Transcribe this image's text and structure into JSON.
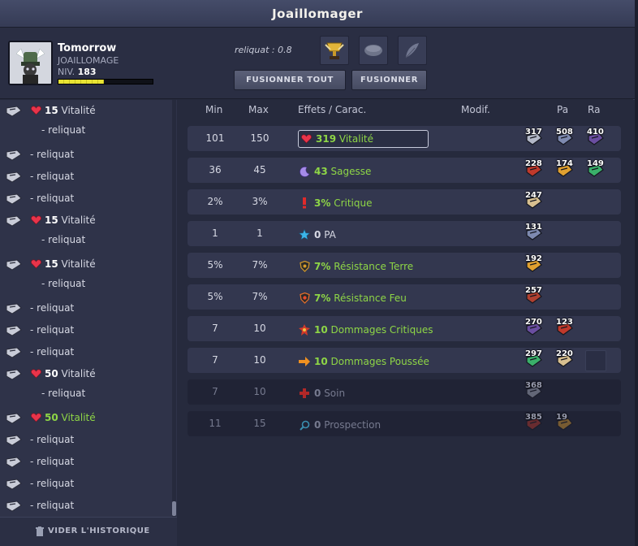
{
  "window": {
    "title": "Joaillomager"
  },
  "character": {
    "name": "Tomorrow",
    "job": "JOAILLOMAGE",
    "level_label": "NIV.",
    "level": "183",
    "xp_fraction": 0.48
  },
  "forge": {
    "reliquat": "reliquat : 0.8",
    "buttons": {
      "fusionner_tout": "FUSIONNER TOUT",
      "fusionner": "FUSIONNER"
    },
    "slots": [
      "trophy-rune-icon",
      "slot-stone-icon",
      "feather-icon"
    ]
  },
  "history": {
    "items": [
      {
        "text_value": "15",
        "text": "Vitalité",
        "sub": "- reliquat"
      },
      {
        "text": "- reliquat"
      },
      {
        "text": "- reliquat"
      },
      {
        "text": "- reliquat"
      },
      {
        "text_value": "15",
        "text": "Vitalité",
        "sub": "- reliquat"
      },
      {
        "text_value": "15",
        "text": "Vitalité",
        "sub": "- reliquat"
      },
      {
        "text": "- reliquat"
      },
      {
        "text": "- reliquat"
      },
      {
        "text": "- reliquat"
      },
      {
        "text_value": "50",
        "text": "Vitalité",
        "sub": "- reliquat"
      },
      {
        "text_value": "50",
        "text": "Vitalité",
        "highlight": true
      },
      {
        "text": "- reliquat"
      },
      {
        "text": "- reliquat"
      },
      {
        "text": "- reliquat"
      },
      {
        "text": "- reliquat"
      }
    ],
    "clear_label": "VIDER L'HISTORIQUE"
  },
  "table": {
    "headers": {
      "min": "Min",
      "max": "Max",
      "effects": "Effets / Carac.",
      "modif": "Modif.",
      "pa": "Pa",
      "ra": "Ra"
    },
    "rows": [
      {
        "min": "101",
        "max": "150",
        "value": "319",
        "effect": "Vitalité",
        "icon": "heart-icon",
        "selected": true,
        "runes": [
          "317",
          "508",
          "410"
        ]
      },
      {
        "min": "36",
        "max": "45",
        "value": "43",
        "effect": "Sagesse",
        "icon": "moon-icon",
        "runes": [
          "228",
          "174",
          "149"
        ]
      },
      {
        "min": "2%",
        "max": "3%",
        "value": "3%",
        "effect": "Critique",
        "icon": "exclamation-icon",
        "runes": [
          "247"
        ]
      },
      {
        "min": "1",
        "max": "1",
        "value": "0",
        "effect": "PA",
        "icon": "star-icon",
        "white": true,
        "runes": [
          "131"
        ]
      },
      {
        "min": "5%",
        "max": "7%",
        "value": "7%",
        "effect": "Résistance Terre",
        "icon": "shield-earth-icon",
        "runes": [
          "192"
        ]
      },
      {
        "min": "5%",
        "max": "7%",
        "value": "7%",
        "effect": "Résistance Feu",
        "icon": "shield-fire-icon",
        "runes": [
          "257"
        ]
      },
      {
        "min": "7",
        "max": "10",
        "value": "10",
        "effect": "Dommages Critiques",
        "icon": "crit-damage-icon",
        "runes": [
          "270",
          "123"
        ]
      },
      {
        "min": "7",
        "max": "10",
        "value": "10",
        "effect": "Dommages Poussée",
        "icon": "arrow-right-icon",
        "runes": [
          "297",
          "220"
        ],
        "empty_ra": true
      },
      {
        "min": "7",
        "max": "10",
        "value": "0",
        "effect": "Soin",
        "icon": "cross-icon",
        "dim": true,
        "runes": [
          "368"
        ]
      },
      {
        "min": "11",
        "max": "15",
        "value": "0",
        "effect": "Prospection",
        "icon": "magnifier-icon",
        "dim": true,
        "runes": [
          "385",
          "19"
        ]
      }
    ]
  },
  "colors": {
    "green": "#8ed646",
    "panel": "#262a3d",
    "row": "#33374f"
  }
}
